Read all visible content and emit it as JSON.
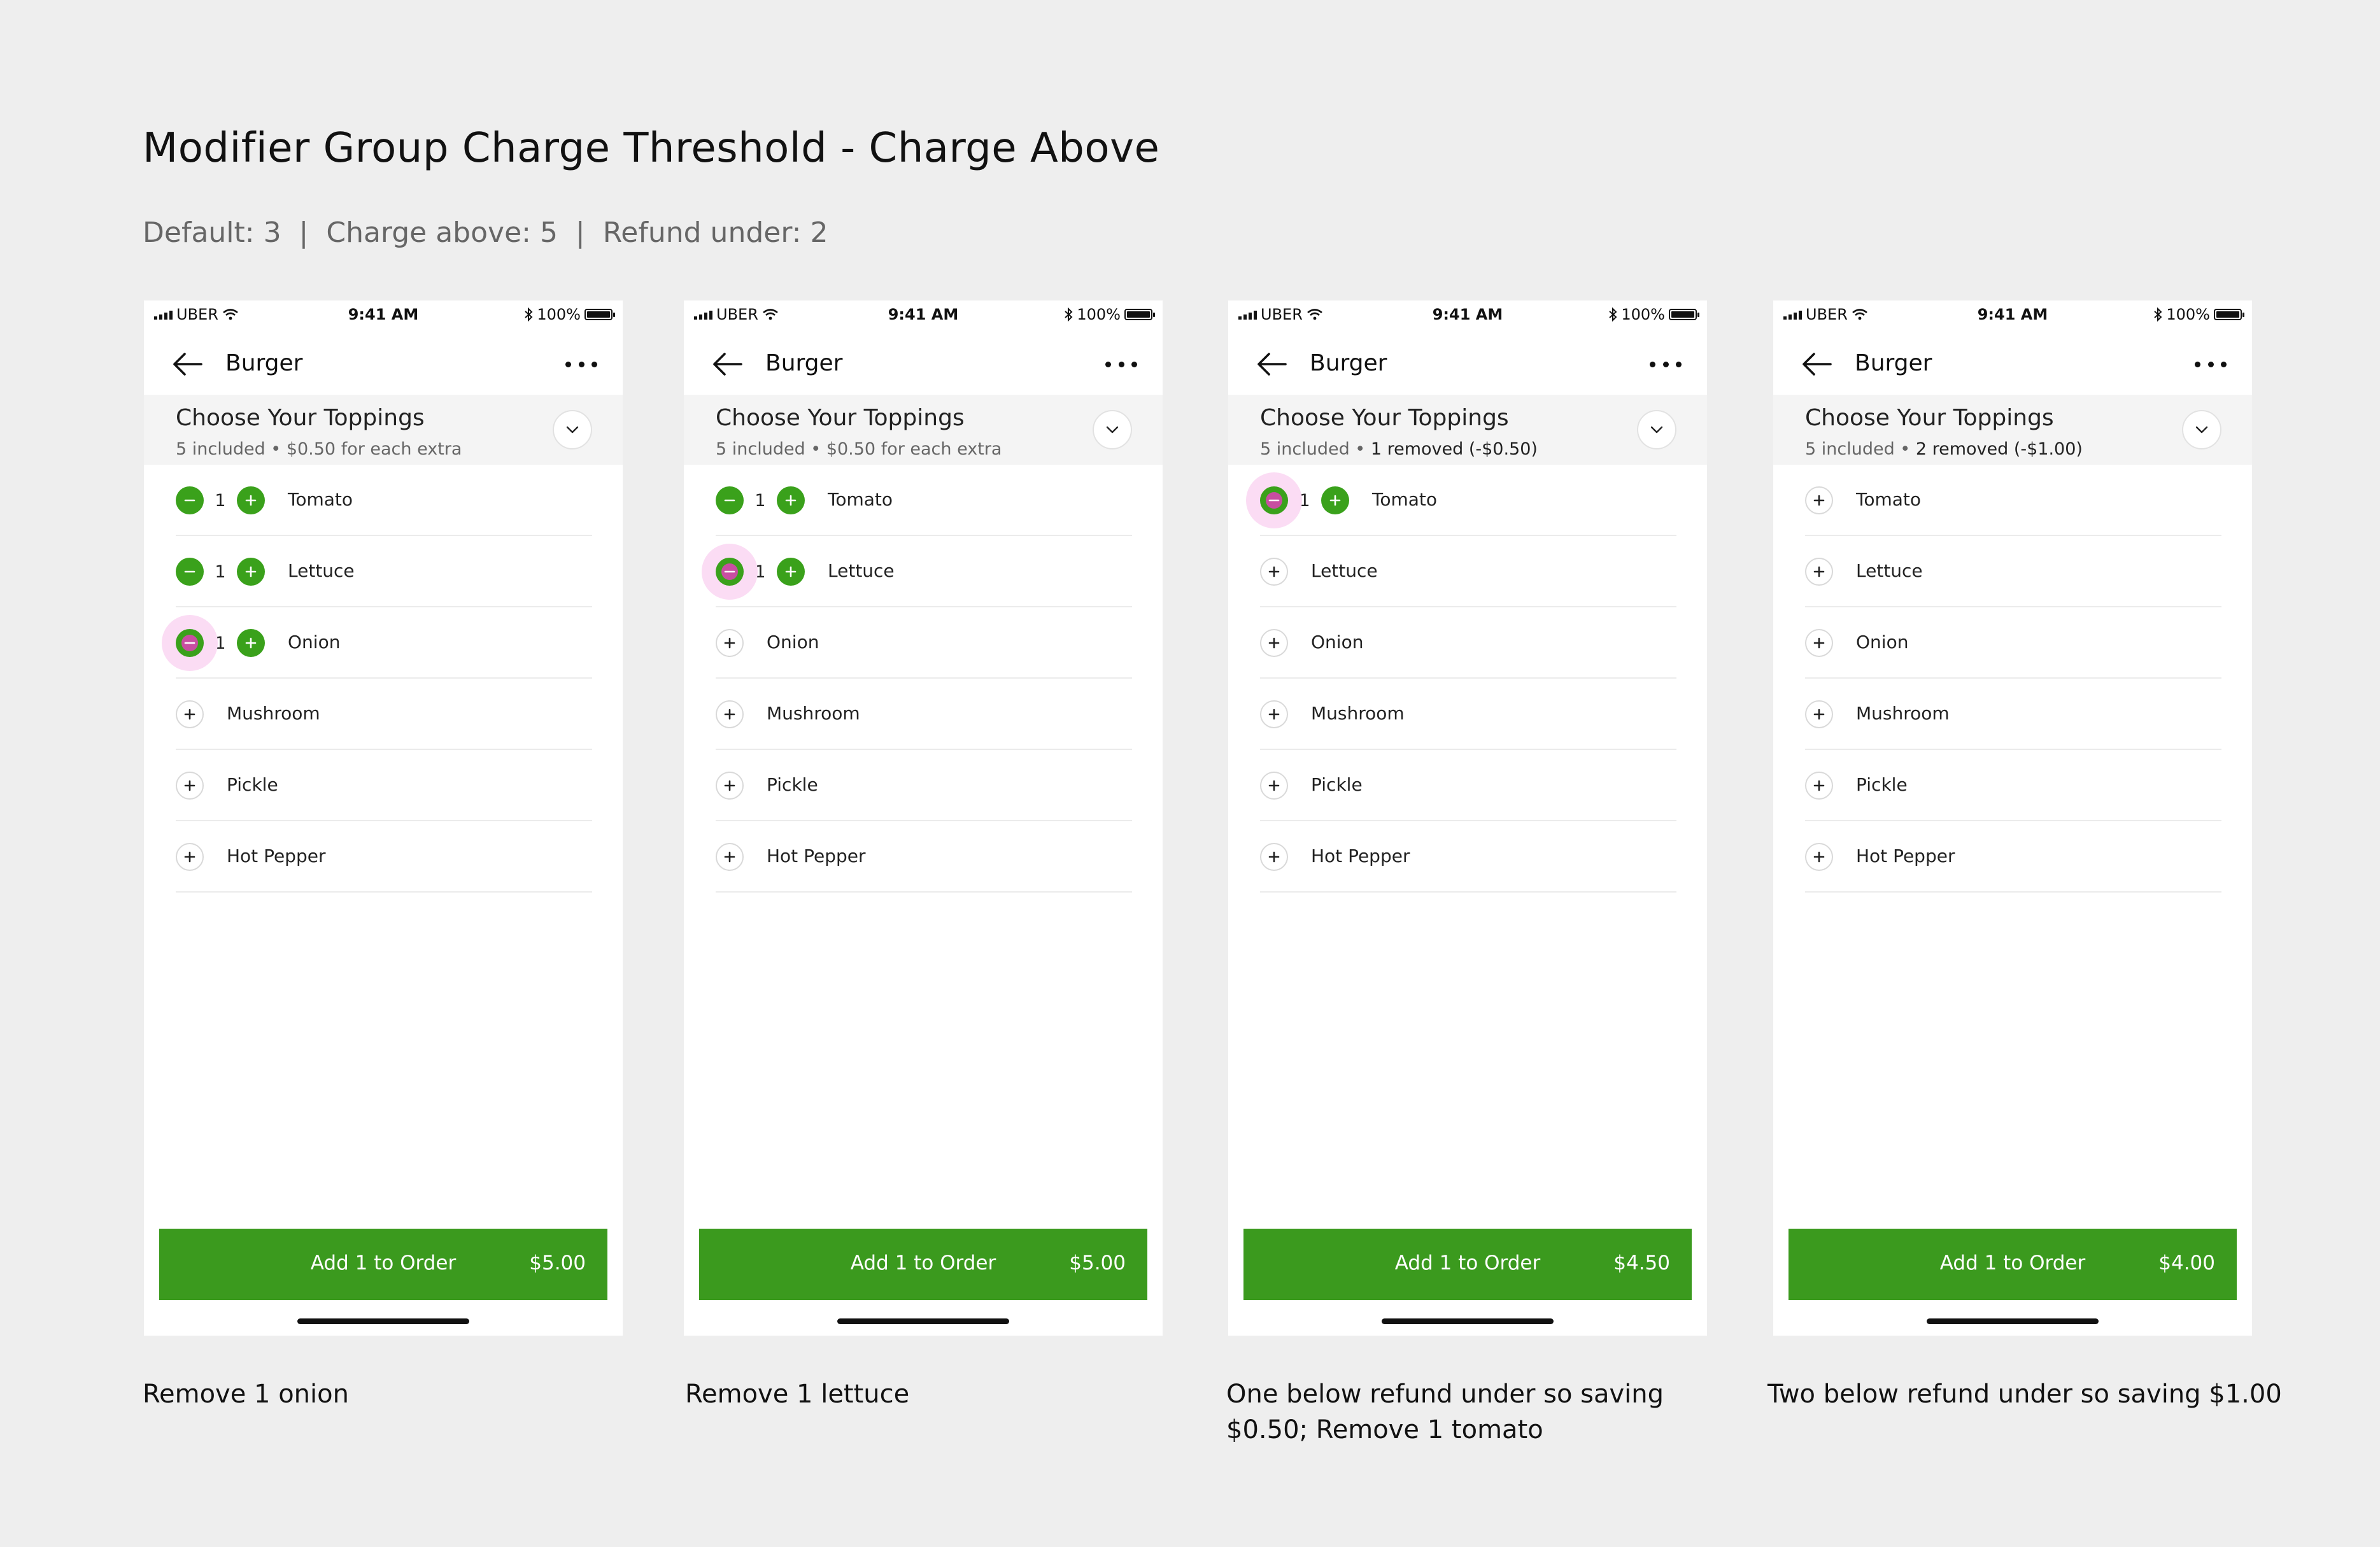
{
  "title": "Modifier Group Charge Threshold - Charge Above",
  "subtitle": "Default: 3  |  Charge above: 5  |  Refund under: 2",
  "colors": {
    "accent_green": "#3aa11b",
    "press_highlight": "#e23fb8",
    "background": "#eeeeee"
  },
  "screens": [
    {
      "status": {
        "carrier": "UBER",
        "time": "9:41 AM",
        "battery": "100%"
      },
      "nav": {
        "title": "Burger",
        "back_icon": "arrow-left-icon",
        "more_icon": "more-horizontal-icon"
      },
      "group": {
        "title": "Choose Your Toppings",
        "desc_prefix": "5 included • ",
        "desc_main": "$0.50 for each extra"
      },
      "items": [
        {
          "name": "Tomato",
          "qty": "1",
          "selected": true,
          "pressed": false
        },
        {
          "name": "Lettuce",
          "qty": "1",
          "selected": true,
          "pressed": false
        },
        {
          "name": "Onion",
          "qty": "1",
          "selected": true,
          "pressed": true
        },
        {
          "name": "Mushroom",
          "qty": "",
          "selected": false,
          "pressed": false
        },
        {
          "name": "Pickle",
          "qty": "",
          "selected": false,
          "pressed": false
        },
        {
          "name": "Hot Pepper",
          "qty": "",
          "selected": false,
          "pressed": false
        }
      ],
      "cta": {
        "label": "Add 1 to Order",
        "price": "$5.00"
      },
      "caption": "Remove 1 onion"
    },
    {
      "status": {
        "carrier": "UBER",
        "time": "9:41 AM",
        "battery": "100%"
      },
      "nav": {
        "title": "Burger",
        "back_icon": "arrow-left-icon",
        "more_icon": "more-horizontal-icon"
      },
      "group": {
        "title": "Choose Your Toppings",
        "desc_prefix": "5 included • ",
        "desc_main": "$0.50 for each extra"
      },
      "items": [
        {
          "name": "Tomato",
          "qty": "1",
          "selected": true,
          "pressed": false
        },
        {
          "name": "Lettuce",
          "qty": "1",
          "selected": true,
          "pressed": true
        },
        {
          "name": "Onion",
          "qty": "",
          "selected": false,
          "pressed": false
        },
        {
          "name": "Mushroom",
          "qty": "",
          "selected": false,
          "pressed": false
        },
        {
          "name": "Pickle",
          "qty": "",
          "selected": false,
          "pressed": false
        },
        {
          "name": "Hot Pepper",
          "qty": "",
          "selected": false,
          "pressed": false
        }
      ],
      "cta": {
        "label": "Add 1 to Order",
        "price": "$5.00"
      },
      "caption": "Remove 1 lettuce"
    },
    {
      "status": {
        "carrier": "UBER",
        "time": "9:41 AM",
        "battery": "100%"
      },
      "nav": {
        "title": "Burger",
        "back_icon": "arrow-left-icon",
        "more_icon": "more-horizontal-icon"
      },
      "group": {
        "title": "Choose Your Toppings",
        "desc_prefix": "5 included • ",
        "desc_main": "1 removed (-$0.50)"
      },
      "items": [
        {
          "name": "Tomato",
          "qty": "1",
          "selected": true,
          "pressed": true
        },
        {
          "name": "Lettuce",
          "qty": "",
          "selected": false,
          "pressed": false
        },
        {
          "name": "Onion",
          "qty": "",
          "selected": false,
          "pressed": false
        },
        {
          "name": "Mushroom",
          "qty": "",
          "selected": false,
          "pressed": false
        },
        {
          "name": "Pickle",
          "qty": "",
          "selected": false,
          "pressed": false
        },
        {
          "name": "Hot Pepper",
          "qty": "",
          "selected": false,
          "pressed": false
        }
      ],
      "cta": {
        "label": "Add 1 to Order",
        "price": "$4.50"
      },
      "caption": "One below refund under so saving\n$0.50; Remove 1 tomato"
    },
    {
      "status": {
        "carrier": "UBER",
        "time": "9:41 AM",
        "battery": "100%"
      },
      "nav": {
        "title": "Burger",
        "back_icon": "arrow-left-icon",
        "more_icon": "more-horizontal-icon"
      },
      "group": {
        "title": "Choose Your Toppings",
        "desc_prefix": "5 included • ",
        "desc_main": "2 removed (-$1.00)"
      },
      "items": [
        {
          "name": "Tomato",
          "qty": "",
          "selected": false,
          "pressed": false
        },
        {
          "name": "Lettuce",
          "qty": "",
          "selected": false,
          "pressed": false
        },
        {
          "name": "Onion",
          "qty": "",
          "selected": false,
          "pressed": false
        },
        {
          "name": "Mushroom",
          "qty": "",
          "selected": false,
          "pressed": false
        },
        {
          "name": "Pickle",
          "qty": "",
          "selected": false,
          "pressed": false
        },
        {
          "name": "Hot Pepper",
          "qty": "",
          "selected": false,
          "pressed": false
        }
      ],
      "cta": {
        "label": "Add 1 to Order",
        "price": "$4.00"
      },
      "caption": "Two below refund under so saving $1.00"
    }
  ]
}
